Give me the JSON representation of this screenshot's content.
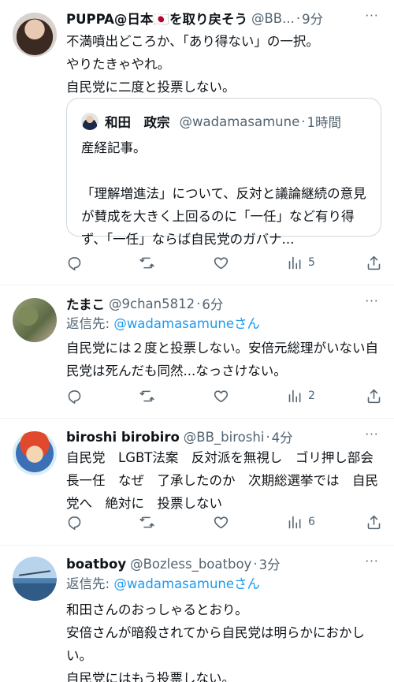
{
  "tweets": [
    {
      "name": "PUPPA@日本🇯🇵を取り戻そう",
      "handle": "@BB...",
      "sep": "·",
      "time": "9分",
      "text": "不満噴出どころか、「あり得ない」の一択。\nやりたきゃやれ。\n自民党に二度と投票しない。",
      "quote": {
        "name": "和田　政宗",
        "handle": "@wadamasamune",
        "sep": "·",
        "time": "1時間",
        "text": "産経記事。\n\n「理解増進法」について、反対と議論継続の意見が賛成を大きく上回るのに「一任」など有り得ず、「一任」ならば自民党のガバナ..."
      },
      "views": "5"
    },
    {
      "name": "たまこ",
      "handle": "@9chan5812",
      "sep": "·",
      "time": "6分",
      "reply_prefix": "返信先: ",
      "reply_mention": "@wadamasamuneさん",
      "text": "自民党には２度と投票しない。安倍元総理がいない自民党は死んだも同然...なっさけない。",
      "views": "2"
    },
    {
      "name": "biroshi birobiro",
      "handle": "@BB_biroshi",
      "sep": "·",
      "time": "4分",
      "text": "自民党　LGBT法案　反対派を無視し　ゴリ押し部会長一任　なぜ　了承したのか　次期総選挙では　自民党へ　絶対に　投票しない",
      "views": "6"
    },
    {
      "name": "boatboy",
      "handle": "@Bozless_boatboy",
      "sep": "·",
      "time": "3分",
      "reply_prefix": "返信先: ",
      "reply_mention": "@wadamasamuneさん",
      "text": "和田さんのおっしゃるとおり。\n安倍さんが暗殺されてから自民党は明らかにおかしい。\n自民党にはもう投票しない。"
    }
  ],
  "icons": {
    "more": "more-horizontal-icon",
    "reply": "reply-icon",
    "retweet": "retweet-icon",
    "like": "heart-icon",
    "views": "views-chart-icon",
    "share": "share-icon"
  },
  "colors": {
    "text": "#0f1419",
    "secondary": "#536471",
    "link": "#1d9bf0",
    "border": "#cfd9de",
    "divider": "#eff3f4"
  }
}
